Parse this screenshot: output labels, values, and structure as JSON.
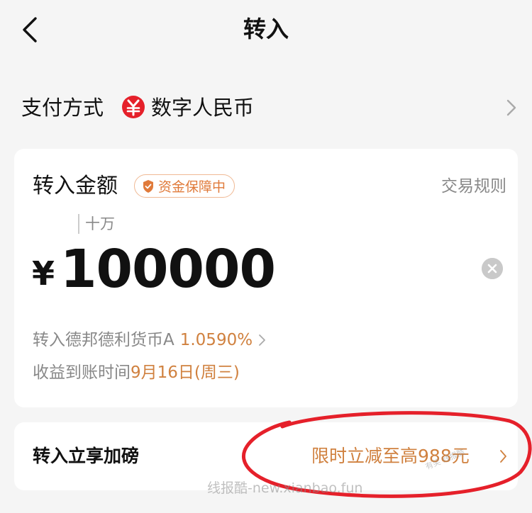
{
  "header": {
    "title": "转入"
  },
  "payment": {
    "label": "支付方式",
    "method": "数字人民币"
  },
  "amount_card": {
    "label": "转入金额",
    "badge": "资金保障中",
    "rules_link": "交易规则",
    "unit_hint": "十万",
    "currency_symbol": "¥",
    "amount_value": "100000",
    "fund_prefix": "转入德邦德利货币A",
    "fund_rate": "1.0590%",
    "arrival_prefix": "收益到账时间",
    "arrival_date": "9月16日(周三)"
  },
  "bonus": {
    "label": "转入立享加磅",
    "promo": "限时立减至高988元"
  },
  "watermark": {
    "text": "线报酷-new.xianbao.fun",
    "corner": "有奖 线报酷"
  },
  "colors": {
    "accent": "#d0813f",
    "badge": "#e07a3a",
    "annotation": "#e5202a",
    "currency_icon": "#e5202a"
  },
  "icons": {
    "back": "chevron-left-icon",
    "currency": "yuan-icon",
    "clear": "clear-icon",
    "shield": "shield-icon"
  }
}
